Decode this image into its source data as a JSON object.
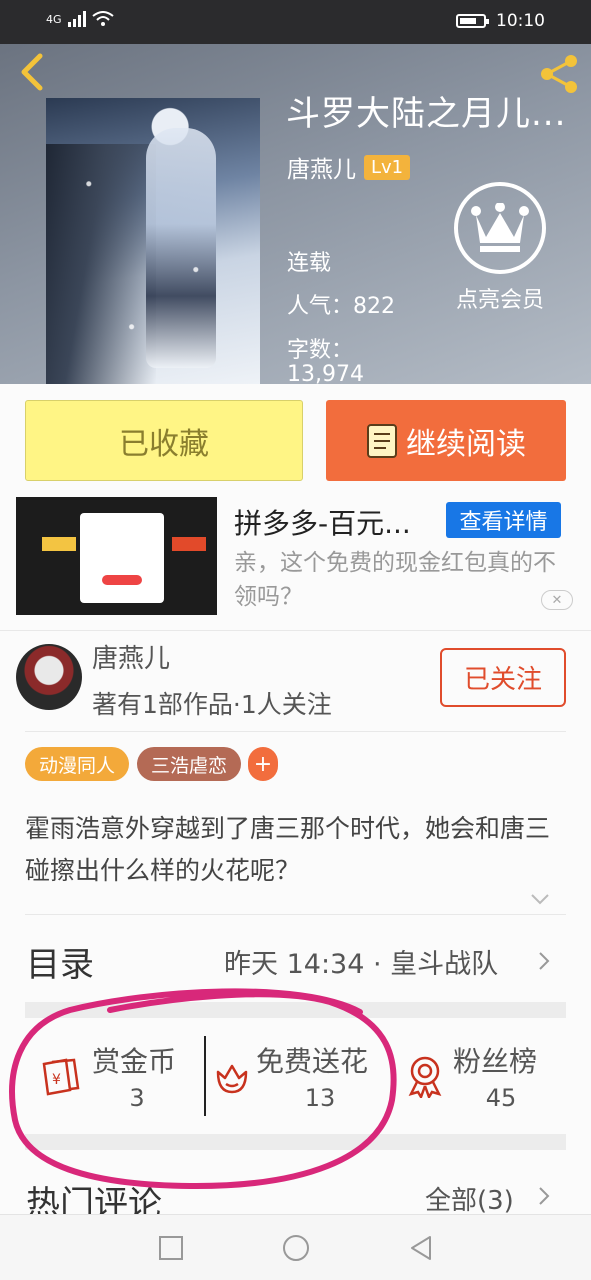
{
  "status_bar": {
    "network": "4G",
    "time": "10:10"
  },
  "book": {
    "title": "斗罗大陆之月儿...",
    "author": "唐燕儿",
    "level": "Lv1",
    "status": "连载",
    "popularity": "人气：822",
    "word_count_label": "字数：",
    "word_count_value": "13,974"
  },
  "vip": {
    "label": "点亮会员"
  },
  "actions": {
    "collected_label": "已收藏",
    "continue_label": "继续阅读"
  },
  "ad": {
    "title": "拼多多-百元...",
    "detail_label": "查看详情",
    "description": "亲，这个免费的现金红包真的不领吗？",
    "close_symbol": "✕"
  },
  "author_card": {
    "name": "唐燕儿",
    "stats": "著有1部作品·1人关注",
    "follow_label": "已关注"
  },
  "tags": [
    {
      "label": "动漫同人",
      "color": "#f3a93a"
    },
    {
      "label": "三浩虐恋",
      "color": "#b46a55"
    }
  ],
  "tag_add": "+",
  "synopsis": "霍雨浩意外穿越到了唐三那个时代，她会和唐三碰擦出什么样的火花呢？",
  "catalog": {
    "title": "目录",
    "latest": "昨天 14:34 · 皇斗战队"
  },
  "stats": [
    {
      "label": "赏金币",
      "value": "3",
      "icon": "red-envelope-icon"
    },
    {
      "label": "免费送花",
      "value": "13",
      "icon": "flower-icon"
    },
    {
      "label": "粉丝榜",
      "value": "45",
      "icon": "medal-icon"
    }
  ],
  "comments": {
    "title": "热门评论",
    "all_label": "全部(3)"
  },
  "colors": {
    "accent": "#f26d3d",
    "collect_bg": "#fff585",
    "annotation": "#d8287a"
  }
}
